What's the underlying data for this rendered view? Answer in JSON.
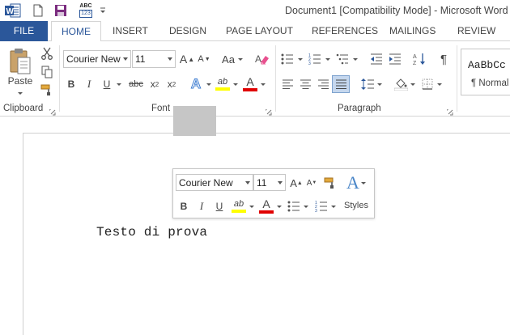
{
  "window": {
    "title": "Document1 [Compatibility Mode] - Microsoft Word l"
  },
  "quick_access": {
    "abc_badge_top": "ABC",
    "abc_badge_bottom": "123"
  },
  "tabs": [
    {
      "label": "FILE"
    },
    {
      "label": "HOME"
    },
    {
      "label": "INSERT"
    },
    {
      "label": "DESIGN"
    },
    {
      "label": "PAGE LAYOUT"
    },
    {
      "label": "REFERENCES"
    },
    {
      "label": "MAILINGS"
    },
    {
      "label": "REVIEW"
    }
  ],
  "ribbon": {
    "clipboard": {
      "paste_label": "Paste",
      "group_label": "Clipboard"
    },
    "font": {
      "font_name": "Courier New",
      "font_size": "11",
      "grow_label": "A",
      "shrink_label": "A",
      "case_label": "Aa",
      "bold_label": "B",
      "italic_label": "I",
      "underline_label": "U",
      "strike_label": "abc",
      "subscript_label": "x",
      "subscript_sub": "2",
      "superscript_label": "x",
      "superscript_sup": "2",
      "effects_label": "A",
      "highlight_label": "ab",
      "color_label": "A",
      "group_label": "Font"
    },
    "paragraph": {
      "group_label": "Paragraph"
    },
    "styles": {
      "sample_text": "AaBbCc",
      "style_name": "¶ Normal"
    }
  },
  "document": {
    "text_before": "Testo di ",
    "text_selected": "prova"
  },
  "mini_toolbar": {
    "font_name": "Courier New",
    "font_size": "11",
    "grow_label": "A",
    "shrink_label": "A",
    "bold_label": "B",
    "italic_label": "I",
    "underline_label": "U",
    "highlight_label": "ab",
    "color_label": "A",
    "styles_glyph": "A",
    "styles_label": "Styles"
  },
  "colors": {
    "accent": "#2b579a",
    "highlight_yellow": "#ffff00",
    "font_color_red": "#e00000",
    "selection_gray": "#c6c6c6"
  }
}
